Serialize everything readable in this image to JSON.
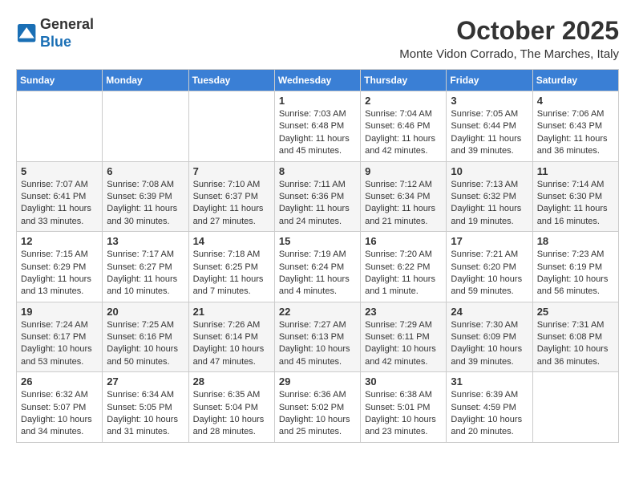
{
  "header": {
    "logo_line1": "General",
    "logo_line2": "Blue",
    "month_title": "October 2025",
    "location": "Monte Vidon Corrado, The Marches, Italy"
  },
  "weekdays": [
    "Sunday",
    "Monday",
    "Tuesday",
    "Wednesday",
    "Thursday",
    "Friday",
    "Saturday"
  ],
  "weeks": [
    [
      {
        "day": "",
        "sunrise": "",
        "sunset": "",
        "daylight": ""
      },
      {
        "day": "",
        "sunrise": "",
        "sunset": "",
        "daylight": ""
      },
      {
        "day": "",
        "sunrise": "",
        "sunset": "",
        "daylight": ""
      },
      {
        "day": "1",
        "sunrise": "Sunrise: 7:03 AM",
        "sunset": "Sunset: 6:48 PM",
        "daylight": "Daylight: 11 hours and 45 minutes."
      },
      {
        "day": "2",
        "sunrise": "Sunrise: 7:04 AM",
        "sunset": "Sunset: 6:46 PM",
        "daylight": "Daylight: 11 hours and 42 minutes."
      },
      {
        "day": "3",
        "sunrise": "Sunrise: 7:05 AM",
        "sunset": "Sunset: 6:44 PM",
        "daylight": "Daylight: 11 hours and 39 minutes."
      },
      {
        "day": "4",
        "sunrise": "Sunrise: 7:06 AM",
        "sunset": "Sunset: 6:43 PM",
        "daylight": "Daylight: 11 hours and 36 minutes."
      }
    ],
    [
      {
        "day": "5",
        "sunrise": "Sunrise: 7:07 AM",
        "sunset": "Sunset: 6:41 PM",
        "daylight": "Daylight: 11 hours and 33 minutes."
      },
      {
        "day": "6",
        "sunrise": "Sunrise: 7:08 AM",
        "sunset": "Sunset: 6:39 PM",
        "daylight": "Daylight: 11 hours and 30 minutes."
      },
      {
        "day": "7",
        "sunrise": "Sunrise: 7:10 AM",
        "sunset": "Sunset: 6:37 PM",
        "daylight": "Daylight: 11 hours and 27 minutes."
      },
      {
        "day": "8",
        "sunrise": "Sunrise: 7:11 AM",
        "sunset": "Sunset: 6:36 PM",
        "daylight": "Daylight: 11 hours and 24 minutes."
      },
      {
        "day": "9",
        "sunrise": "Sunrise: 7:12 AM",
        "sunset": "Sunset: 6:34 PM",
        "daylight": "Daylight: 11 hours and 21 minutes."
      },
      {
        "day": "10",
        "sunrise": "Sunrise: 7:13 AM",
        "sunset": "Sunset: 6:32 PM",
        "daylight": "Daylight: 11 hours and 19 minutes."
      },
      {
        "day": "11",
        "sunrise": "Sunrise: 7:14 AM",
        "sunset": "Sunset: 6:30 PM",
        "daylight": "Daylight: 11 hours and 16 minutes."
      }
    ],
    [
      {
        "day": "12",
        "sunrise": "Sunrise: 7:15 AM",
        "sunset": "Sunset: 6:29 PM",
        "daylight": "Daylight: 11 hours and 13 minutes."
      },
      {
        "day": "13",
        "sunrise": "Sunrise: 7:17 AM",
        "sunset": "Sunset: 6:27 PM",
        "daylight": "Daylight: 11 hours and 10 minutes."
      },
      {
        "day": "14",
        "sunrise": "Sunrise: 7:18 AM",
        "sunset": "Sunset: 6:25 PM",
        "daylight": "Daylight: 11 hours and 7 minutes."
      },
      {
        "day": "15",
        "sunrise": "Sunrise: 7:19 AM",
        "sunset": "Sunset: 6:24 PM",
        "daylight": "Daylight: 11 hours and 4 minutes."
      },
      {
        "day": "16",
        "sunrise": "Sunrise: 7:20 AM",
        "sunset": "Sunset: 6:22 PM",
        "daylight": "Daylight: 11 hours and 1 minute."
      },
      {
        "day": "17",
        "sunrise": "Sunrise: 7:21 AM",
        "sunset": "Sunset: 6:20 PM",
        "daylight": "Daylight: 10 hours and 59 minutes."
      },
      {
        "day": "18",
        "sunrise": "Sunrise: 7:23 AM",
        "sunset": "Sunset: 6:19 PM",
        "daylight": "Daylight: 10 hours and 56 minutes."
      }
    ],
    [
      {
        "day": "19",
        "sunrise": "Sunrise: 7:24 AM",
        "sunset": "Sunset: 6:17 PM",
        "daylight": "Daylight: 10 hours and 53 minutes."
      },
      {
        "day": "20",
        "sunrise": "Sunrise: 7:25 AM",
        "sunset": "Sunset: 6:16 PM",
        "daylight": "Daylight: 10 hours and 50 minutes."
      },
      {
        "day": "21",
        "sunrise": "Sunrise: 7:26 AM",
        "sunset": "Sunset: 6:14 PM",
        "daylight": "Daylight: 10 hours and 47 minutes."
      },
      {
        "day": "22",
        "sunrise": "Sunrise: 7:27 AM",
        "sunset": "Sunset: 6:13 PM",
        "daylight": "Daylight: 10 hours and 45 minutes."
      },
      {
        "day": "23",
        "sunrise": "Sunrise: 7:29 AM",
        "sunset": "Sunset: 6:11 PM",
        "daylight": "Daylight: 10 hours and 42 minutes."
      },
      {
        "day": "24",
        "sunrise": "Sunrise: 7:30 AM",
        "sunset": "Sunset: 6:09 PM",
        "daylight": "Daylight: 10 hours and 39 minutes."
      },
      {
        "day": "25",
        "sunrise": "Sunrise: 7:31 AM",
        "sunset": "Sunset: 6:08 PM",
        "daylight": "Daylight: 10 hours and 36 minutes."
      }
    ],
    [
      {
        "day": "26",
        "sunrise": "Sunrise: 6:32 AM",
        "sunset": "Sunset: 5:07 PM",
        "daylight": "Daylight: 10 hours and 34 minutes."
      },
      {
        "day": "27",
        "sunrise": "Sunrise: 6:34 AM",
        "sunset": "Sunset: 5:05 PM",
        "daylight": "Daylight: 10 hours and 31 minutes."
      },
      {
        "day": "28",
        "sunrise": "Sunrise: 6:35 AM",
        "sunset": "Sunset: 5:04 PM",
        "daylight": "Daylight: 10 hours and 28 minutes."
      },
      {
        "day": "29",
        "sunrise": "Sunrise: 6:36 AM",
        "sunset": "Sunset: 5:02 PM",
        "daylight": "Daylight: 10 hours and 25 minutes."
      },
      {
        "day": "30",
        "sunrise": "Sunrise: 6:38 AM",
        "sunset": "Sunset: 5:01 PM",
        "daylight": "Daylight: 10 hours and 23 minutes."
      },
      {
        "day": "31",
        "sunrise": "Sunrise: 6:39 AM",
        "sunset": "Sunset: 4:59 PM",
        "daylight": "Daylight: 10 hours and 20 minutes."
      },
      {
        "day": "",
        "sunrise": "",
        "sunset": "",
        "daylight": ""
      }
    ]
  ]
}
